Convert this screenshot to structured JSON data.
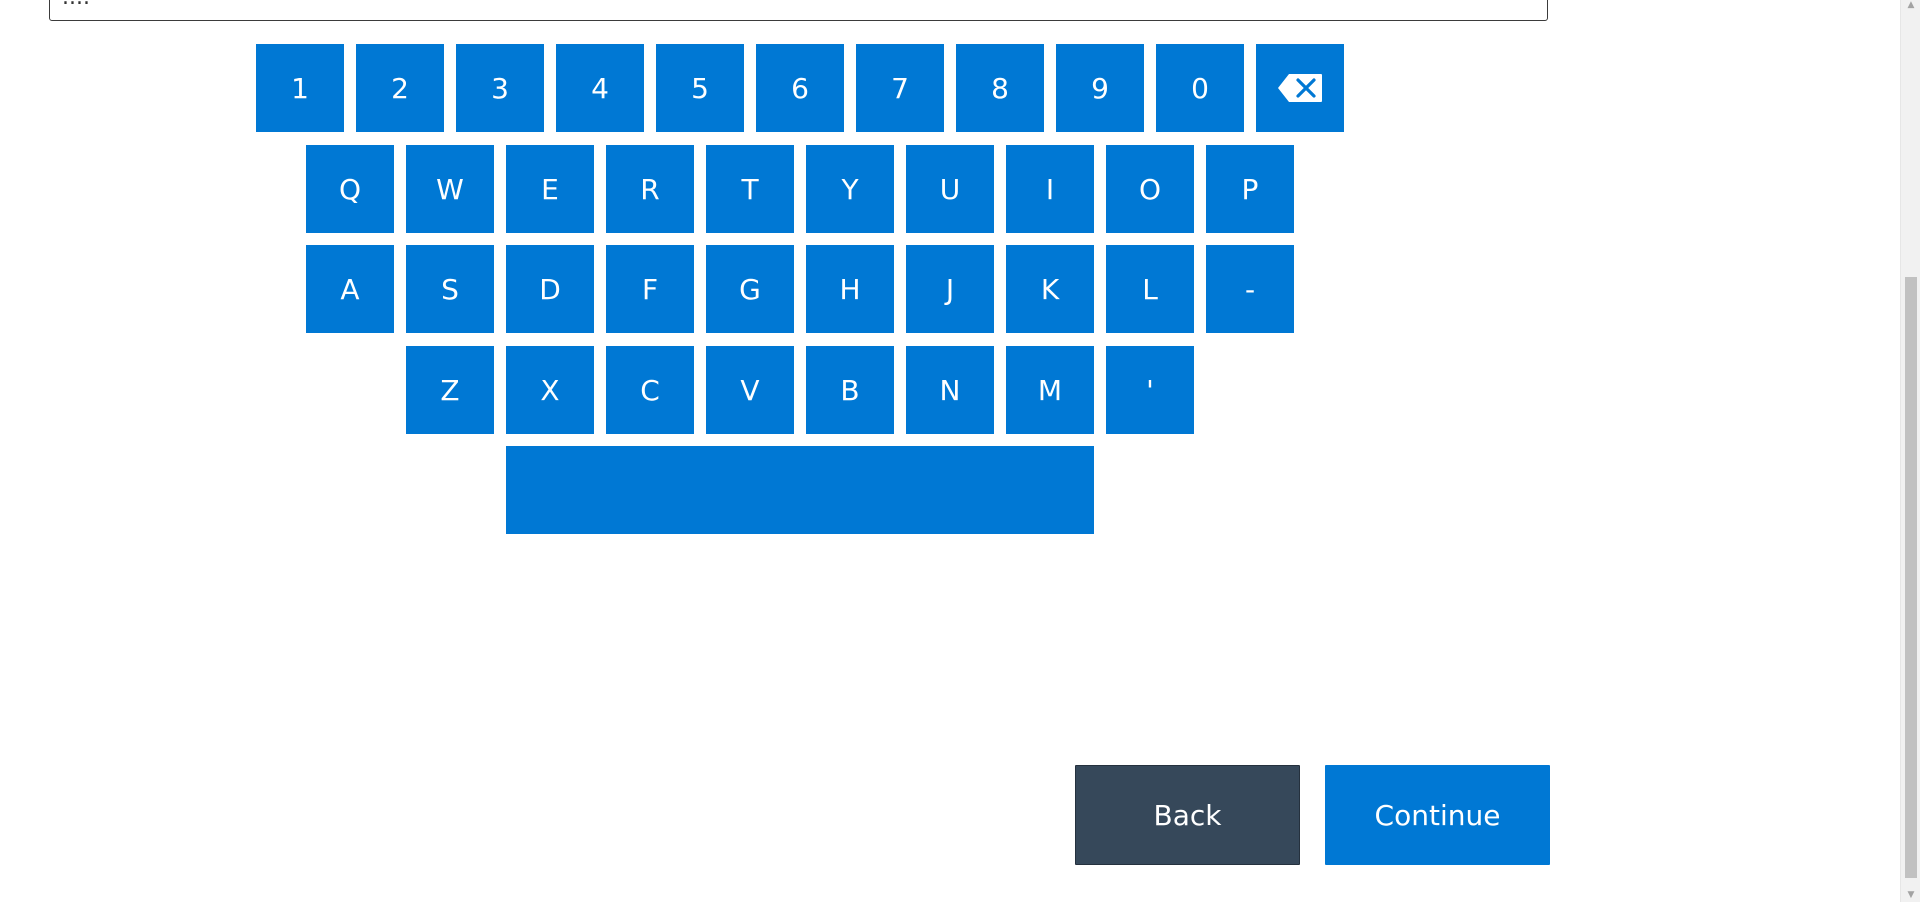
{
  "text_field": {
    "value": "...."
  },
  "keyboard": {
    "row1": [
      "1",
      "2",
      "3",
      "4",
      "5",
      "6",
      "7",
      "8",
      "9",
      "0"
    ],
    "backspace_icon": "backspace-icon",
    "row2": [
      "Q",
      "W",
      "E",
      "R",
      "T",
      "Y",
      "U",
      "I",
      "O",
      "P"
    ],
    "row3": [
      "A",
      "S",
      "D",
      "F",
      "G",
      "H",
      "J",
      "K",
      "L",
      "-"
    ],
    "row4": [
      "Z",
      "X",
      "C",
      "V",
      "B",
      "N",
      "M",
      "'"
    ],
    "space_label": ""
  },
  "actions": {
    "back_label": "Back",
    "continue_label": "Continue"
  },
  "colors": {
    "key_blue": "#0078d4",
    "back_dark": "#36485a"
  },
  "scrollbar": {
    "up_icon": "scroll-up-arrow-icon",
    "down_icon": "scroll-down-arrow-icon"
  }
}
